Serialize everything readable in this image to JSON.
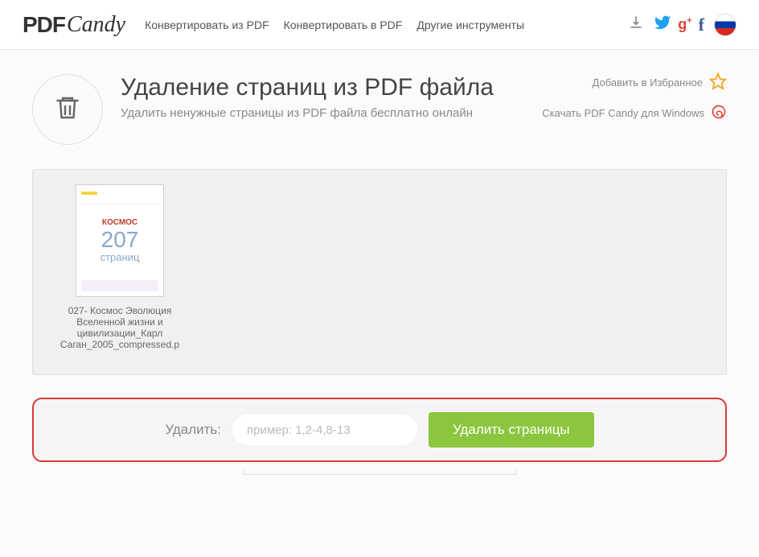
{
  "logo": {
    "part1": "PDF",
    "part2": "Candy"
  },
  "nav": {
    "convert_from": "Конвертировать из PDF",
    "convert_to": "Конвертировать в PDF",
    "other_tools": "Другие инструменты"
  },
  "sidelinks": {
    "favorite": "Добавить в Избранное",
    "download_win": "Скачать PDF Candy для Windows"
  },
  "hero": {
    "title": "Удаление страниц из PDF файла",
    "subtitle": "Удалить ненужные страницы из PDF файла бесплатно онлайн"
  },
  "file": {
    "thumb_title": "КОСМОС",
    "page_count": "207",
    "page_label": "страниц",
    "filename": "027- Космос Эволюция Вселенной жизни и цивилизации_Карл Саган_2005_compressed.p"
  },
  "action": {
    "label": "Удалить:",
    "placeholder": "пример: 1,2-4,8-13",
    "button": "Удалить страницы"
  },
  "colors": {
    "accent_green": "#8bc63e",
    "highlight_red": "#d93838",
    "twitter": "#1da1f2",
    "gplus": "#db4437",
    "fb": "#3b5998"
  }
}
